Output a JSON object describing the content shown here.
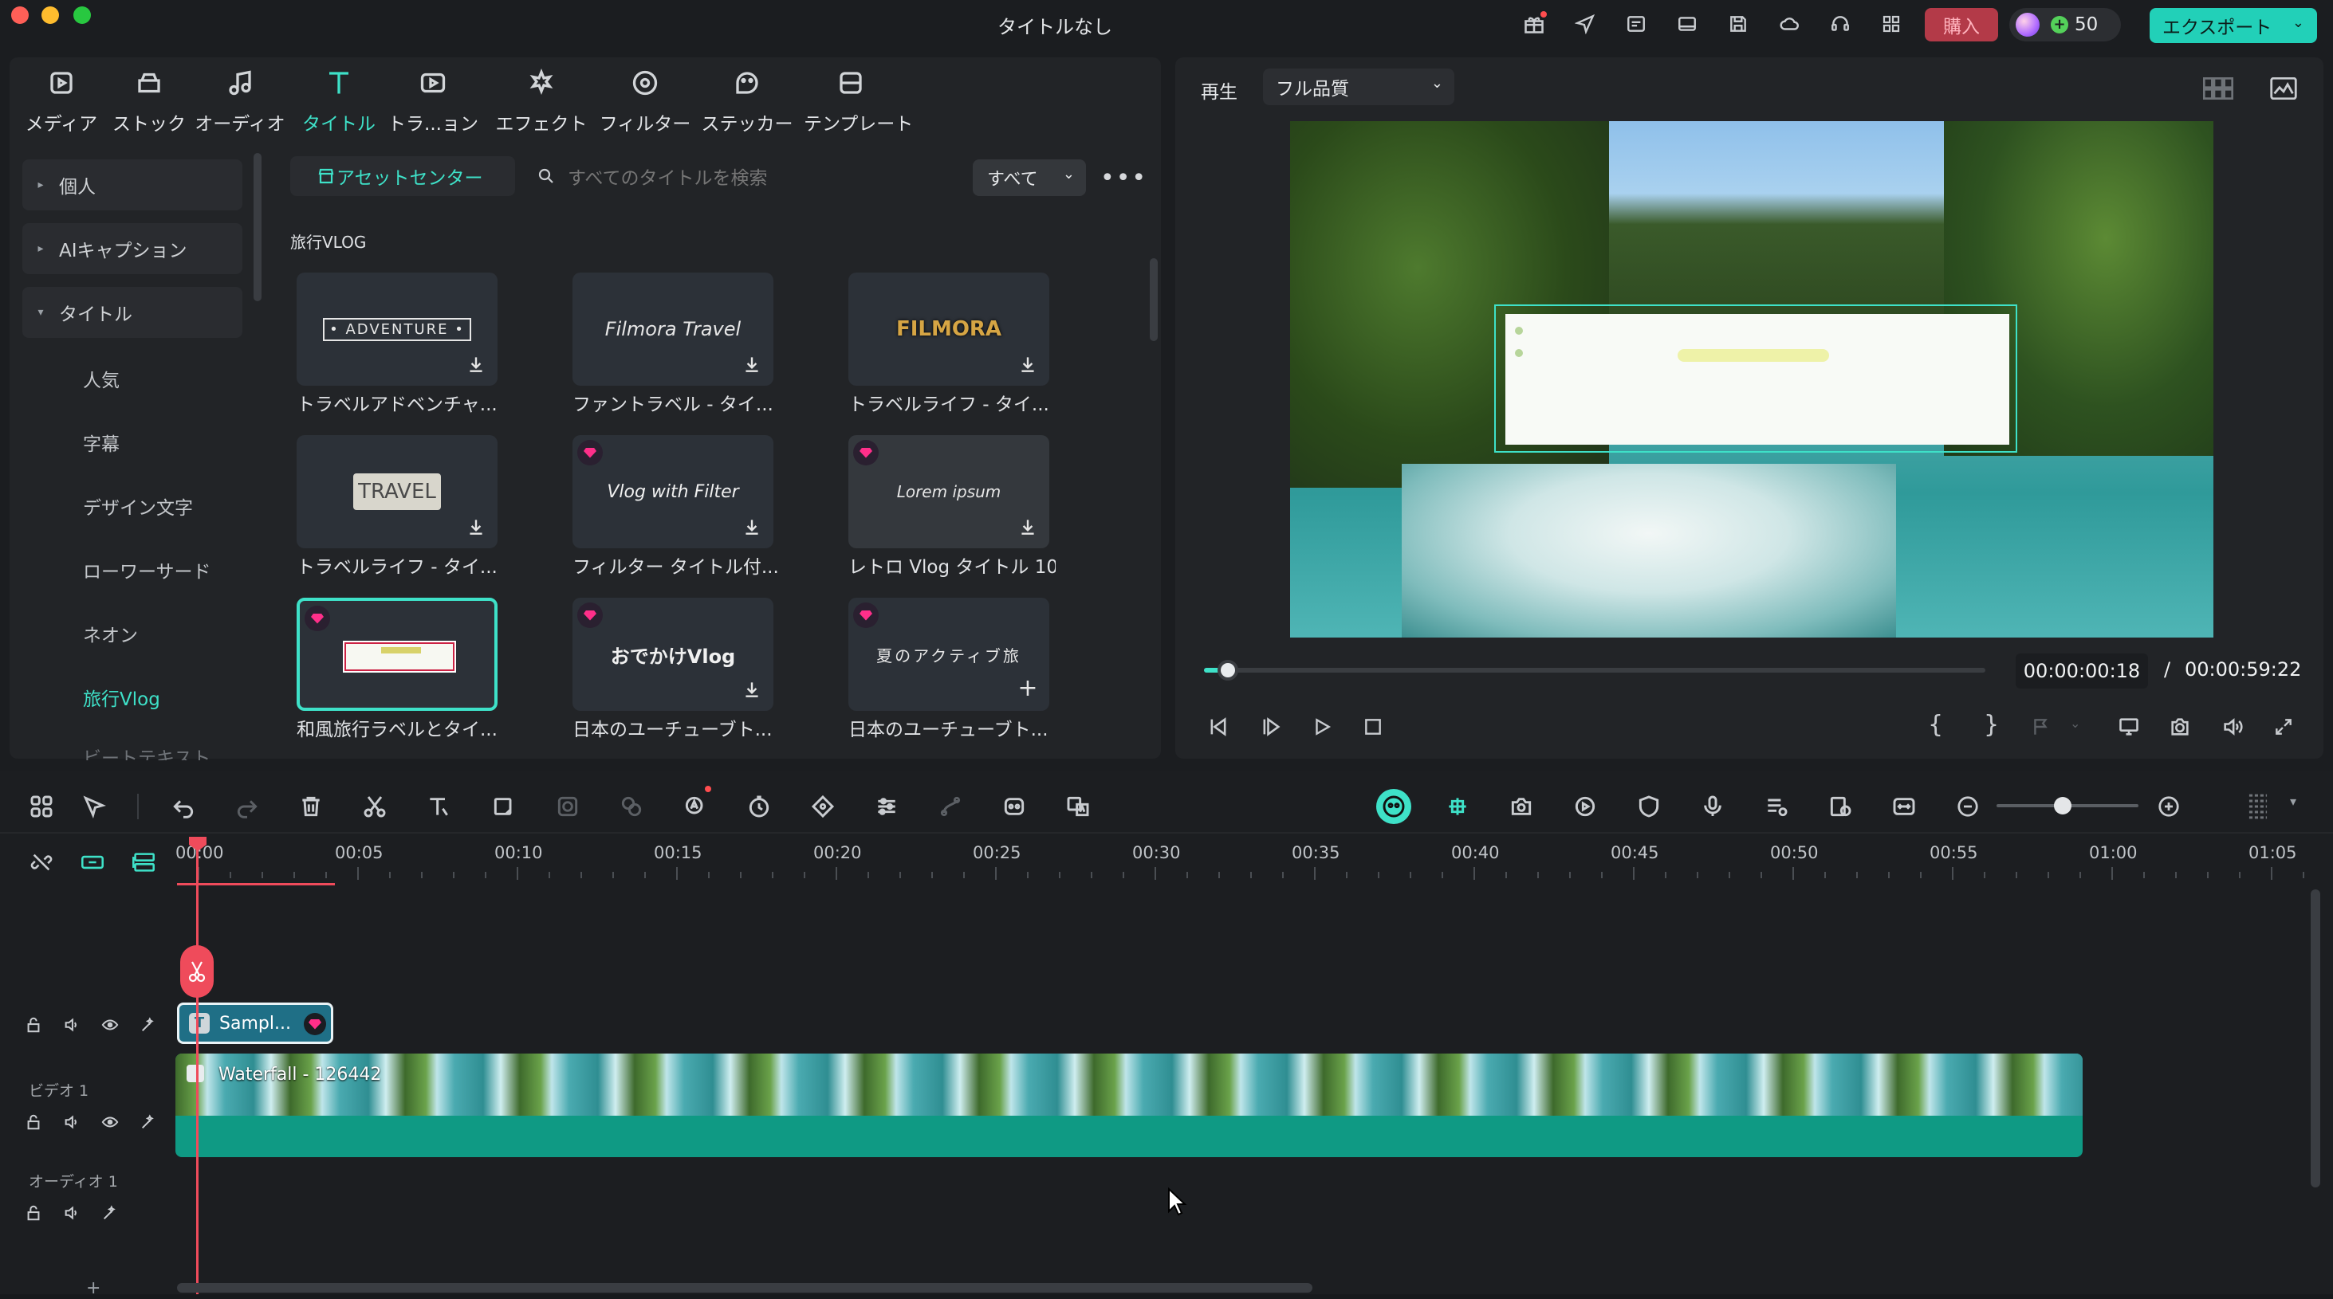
{
  "window": {
    "title": "タイトルなし",
    "buy_label": "購入",
    "credits": "50",
    "export_label": "エクスポート",
    "accent": "#3ee1c8",
    "buy_color": "#b33a48"
  },
  "media_tabs": [
    {
      "label": "メディア",
      "icon": "media-icon"
    },
    {
      "label": "ストック",
      "icon": "stock-icon"
    },
    {
      "label": "オーディオ",
      "icon": "music-note-icon"
    },
    {
      "label": "タイトル",
      "icon": "title-t-icon",
      "active": true
    },
    {
      "label": "トラ...ョン",
      "icon": "transition-icon"
    },
    {
      "label": "エフェクト",
      "icon": "effect-icon"
    },
    {
      "label": "フィルター",
      "icon": "filter-icon"
    },
    {
      "label": "ステッカー",
      "icon": "sticker-icon"
    },
    {
      "label": "テンプレート",
      "icon": "template-icon"
    }
  ],
  "sidebar": {
    "groups": [
      "個人",
      "AIキャプション",
      "タイトル"
    ],
    "items": [
      "人気",
      "字幕",
      "デザイン文字",
      "ローワーサード",
      "ネオン",
      "旅行Vlog",
      "ビートテキスト"
    ]
  },
  "asset_bar": {
    "asset_center": "アセットセンター",
    "search_placeholder": "すべてのタイトルを検索",
    "filter_value": "すべて"
  },
  "section_title": "旅行VLOG",
  "cards": [
    {
      "label": "トラベルアドベンチャ...",
      "thumb": "• ADVENTURE •"
    },
    {
      "label": "ファントラベル - タイ...",
      "thumb": "Filmora Travel"
    },
    {
      "label": "トラベルライフ - タイ...",
      "thumb": "FILMORA"
    },
    {
      "label": "トラベルライフ - タイ...",
      "thumb": "TRAVEL"
    },
    {
      "label": "フィルター タイトル付...",
      "thumb": "Vlog with Filter"
    },
    {
      "label": "レトロ Vlog タイトル 10",
      "thumb": "Lorem ipsum"
    },
    {
      "label": "和風旅行ラベルとタイ...",
      "thumb": ""
    },
    {
      "label": "日本のユーチューブト...",
      "thumb": "おでかけVlog"
    },
    {
      "label": "日本のユーチューブト...",
      "thumb": "夏のアクティブ旅"
    }
  ],
  "player": {
    "play_label": "再生",
    "quality": "フル品質",
    "current_time": "00:00:00:18",
    "separator": "/",
    "total_time": "00:00:59:22",
    "progress": 0.02
  },
  "timeline": {
    "ruler": [
      "00:00",
      "00:05",
      "00:10",
      "00:15",
      "00:20",
      "00:25",
      "00:30",
      "00:35",
      "00:40",
      "00:45",
      "00:50",
      "00:55",
      "01:00",
      "01:05"
    ],
    "title_clip": "Sampl...",
    "video_track": "ビデオ 1",
    "video_clip": "Waterfall - 126442",
    "audio_track": "オーディオ 1",
    "clip_color": "#0f9a84"
  }
}
